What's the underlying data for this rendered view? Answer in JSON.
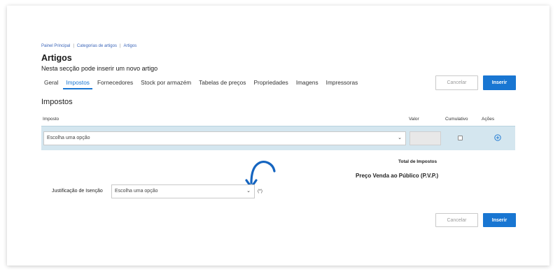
{
  "breadcrumb": {
    "items": [
      "Painel Principal",
      "Categorias de artigos",
      "Artigos"
    ],
    "separator": "|"
  },
  "page": {
    "title": "Artigos",
    "subtitle": "Nesta secção pode inserir um novo artigo"
  },
  "tabs": [
    {
      "label": "Geral",
      "active": false
    },
    {
      "label": "Impostos",
      "active": true
    },
    {
      "label": "Fornecedores",
      "active": false
    },
    {
      "label": "Stock por armazém",
      "active": false
    },
    {
      "label": "Tabelas de preços",
      "active": false
    },
    {
      "label": "Propriedades",
      "active": false
    },
    {
      "label": "Imagens",
      "active": false
    },
    {
      "label": "Impressoras",
      "active": false
    }
  ],
  "actions": {
    "cancel_label": "Cancelar",
    "insert_label": "Inserir"
  },
  "taxes": {
    "section_title": "Impostos",
    "columns": {
      "imposto": "Imposto",
      "valor": "Valor",
      "cumulativo": "Cumulativo",
      "acoes": "Ações"
    },
    "row": {
      "tax_select_value": "Escolha uma opção",
      "valor": "",
      "cumulativo_checked": false,
      "add_icon": "plus-circle-icon"
    },
    "total_label": "Total de Impostos",
    "pvp_label": "Preço Venda ao Público (P.V.P.)"
  },
  "exemption": {
    "label": "Justificação de Isenção",
    "select_value": "Escolha uma opção",
    "required_marker": "(*)"
  },
  "annotation": {
    "icon": "curved-arrow-icon",
    "color": "#1565c0"
  },
  "colors": {
    "accent": "#1976d2",
    "row_background": "#d4e6ef"
  }
}
